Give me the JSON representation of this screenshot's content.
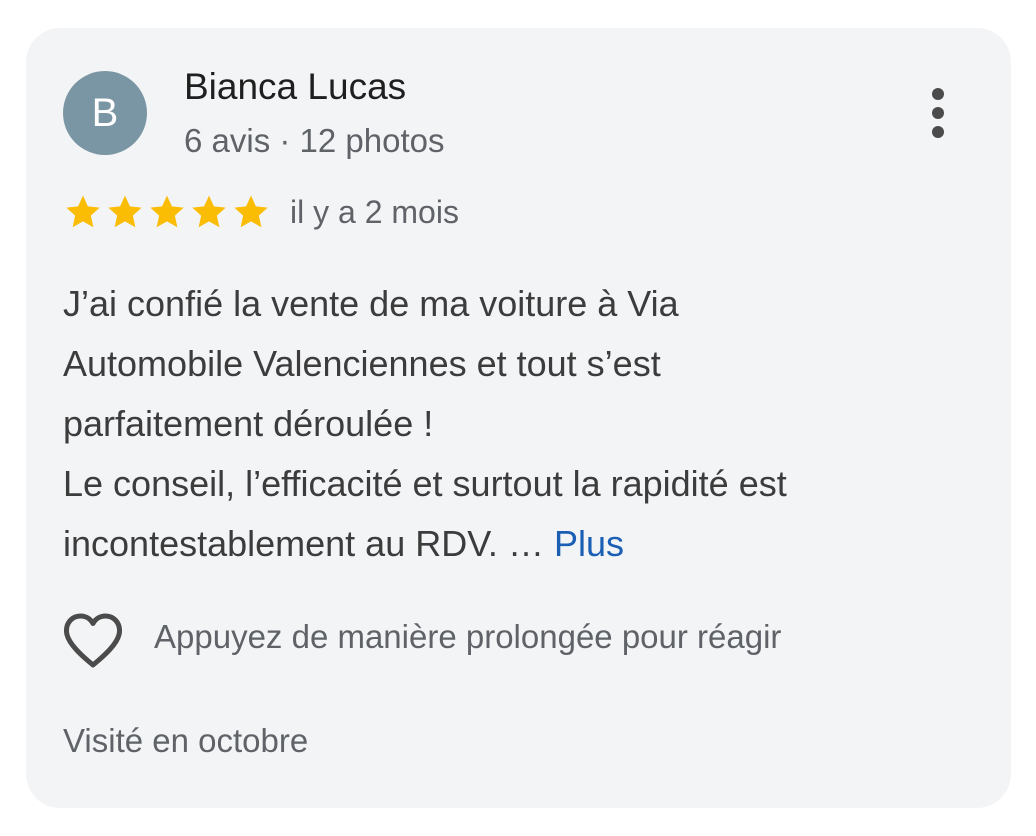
{
  "review": {
    "author": {
      "initial": "B",
      "name": "Bianca Lucas",
      "meta": "6 avis · 12 photos",
      "avatar_color": "#7a96a4"
    },
    "rating": 5,
    "rating_max": 5,
    "star_color": "#fbbc04",
    "time": "il y a 2 mois",
    "text_lines": [
      "J’ai confié la vente de ma voiture à Via",
      "Automobile Valenciennes et tout s’est",
      "parfaitement déroulée !",
      "Le conseil, l’efficacité et surtout la rapidité est",
      "incontestablement au RDV. … "
    ],
    "more_label": "Plus",
    "more_color": "#1a5fb4",
    "reaction_label": "Appuyez de manière prolongée pour réagir",
    "visit": "Visité en octobre",
    "icons": {
      "more": "more-vert-icon",
      "react": "heart-outline-icon",
      "star": "star-icon"
    }
  }
}
